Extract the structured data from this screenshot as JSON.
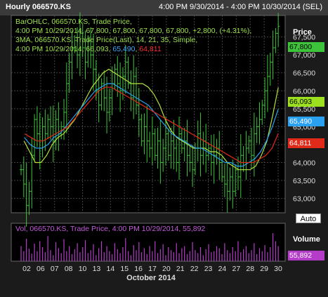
{
  "header": {
    "title": "Hourly 066570.KS",
    "range": "4:00 PM 9/30/2014 - 4:00 PM 10/30/2014 (SEL)"
  },
  "legend": {
    "line1": "BarOHLC, 066570.KS, Trade Price,",
    "line2": "4:00 PM 10/29/2014, 67,800, 67,800, 67,800, 67,800, +2,800, (+4.31%),",
    "line3": "3MA, 066570.KS, Trade Price(Last),  14, 21, 35, Simple,",
    "line4_prefix": "4:00 PM 10/29/2014, 66,093, ",
    "ma2": "65,490",
    "ma3": "64,811"
  },
  "vol_legend": "Vol, 066570.KS, Trade Price,  4:00 PM 10/29/2014, 55,892",
  "price_axis_title": "Price",
  "volume_axis_title": "Volume",
  "auto_button": "Auto",
  "tags": {
    "last": "67,800",
    "ma1": "66,093",
    "ma2": "65,490",
    "ma3": "64,811",
    "vol": "55,892"
  },
  "colors": {
    "bars": "#3ec43a",
    "ma1": "#b6e23a",
    "ma2": "#2aa0f0",
    "ma3": "#e02a1a",
    "volume": "#b43cc8",
    "grid": "#444444"
  },
  "chart_data": [
    {
      "type": "bar",
      "subtype": "ohlc",
      "y_ticks": [
        "67,500",
        "67,000",
        "66,500",
        "66,000",
        "65,500",
        "65,000",
        "64,500",
        "64,000",
        "63,500",
        "63,000"
      ],
      "ylim": [
        62600,
        68100
      ],
      "x_ticks": [
        "02",
        "06",
        "07",
        "08",
        "10",
        "13",
        "14",
        "15",
        "16",
        "17",
        "20",
        "21",
        "22",
        "23",
        "24",
        "27",
        "28",
        "29",
        "30"
      ],
      "x_title": "October 2014",
      "series": [
        {
          "name": "Price",
          "values": [
            63800,
            63400,
            62800,
            63200,
            64200,
            65200,
            64800,
            64400,
            65000,
            64800,
            65200,
            65000,
            64600,
            65200,
            64800,
            65000,
            65400,
            66200,
            66800,
            67200,
            67400,
            67000,
            67600,
            67200,
            66800,
            67400,
            67000,
            66600,
            66000,
            65600,
            66200,
            65800,
            65400,
            65800,
            66200,
            66600,
            66200,
            66000,
            66400,
            66800,
            66200,
            65800,
            66400,
            65600,
            65200,
            64600,
            65000,
            64600,
            64400,
            64800,
            64200,
            64600,
            64000,
            64400,
            64800,
            64200,
            64600,
            64400,
            64000,
            64800,
            64400,
            64600,
            64200,
            64000,
            63800,
            64400,
            64800,
            64200,
            64600,
            64200,
            64400,
            64000,
            64200,
            64400,
            64000,
            63600,
            63400,
            63200,
            63600,
            63200,
            63800,
            63600,
            64200,
            64000,
            64400,
            64600,
            64200,
            64800,
            65000,
            65200,
            65600,
            66000,
            66400,
            66800,
            67200,
            67600,
            67800
          ]
        },
        {
          "name": "3MA 14",
          "values": [
            64600,
            64300,
            64000,
            64000,
            64200,
            64500,
            64700,
            64800,
            65000,
            65200,
            65500,
            65800,
            66100,
            66300,
            66500,
            66600,
            66500,
            66400,
            66300,
            66200,
            66200,
            66200,
            66100,
            65900,
            65600,
            65200,
            64900,
            64700,
            64600,
            64500,
            64400,
            64400,
            64400,
            64300,
            64300,
            64200,
            64000,
            63900,
            63800,
            63800,
            63800,
            63900,
            64200,
            64600,
            65300,
            66093
          ]
        },
        {
          "name": "3MA 21",
          "values": [
            64700,
            64500,
            64400,
            64400,
            64500,
            64700,
            64800,
            65000,
            65200,
            65400,
            65600,
            65800,
            66000,
            66100,
            66200,
            66200,
            66100,
            66000,
            65900,
            65800,
            65700,
            65600,
            65400,
            65200,
            65000,
            64800,
            64700,
            64600,
            64500,
            64400,
            64400,
            64300,
            64200,
            64100,
            64000,
            64000,
            63900,
            63900,
            64000,
            64100,
            64300,
            64600,
            65000,
            65490
          ]
        },
        {
          "name": "3MA 35",
          "values": [
            64800,
            64700,
            64600,
            64600,
            64700,
            64800,
            64900,
            65000,
            65200,
            65400,
            65600,
            65800,
            66000,
            66100,
            66100,
            66000,
            65900,
            65800,
            65700,
            65600,
            65500,
            65400,
            65300,
            65200,
            65100,
            65000,
            64900,
            64800,
            64700,
            64600,
            64500,
            64400,
            64300,
            64200,
            64100,
            64000,
            64000,
            64000,
            64100,
            64200,
            64400,
            64811
          ]
        }
      ]
    },
    {
      "type": "bar",
      "values": [
        30,
        20,
        45,
        25,
        15,
        35,
        20,
        40,
        28,
        18,
        50,
        22,
        12,
        38,
        26,
        16,
        44,
        20,
        30,
        14,
        24,
        36,
        18,
        28,
        42,
        16,
        22,
        34,
        12,
        26,
        40,
        18,
        30,
        20,
        14,
        36,
        24,
        16,
        28,
        46,
        20,
        12,
        32,
        22,
        38,
        18,
        26,
        14,
        30,
        20,
        40,
        16,
        24,
        34,
        12,
        28,
        22,
        18,
        36,
        16,
        26,
        30,
        14,
        20,
        38,
        22,
        16,
        28,
        12,
        24,
        34,
        18,
        20,
        30,
        26,
        14,
        36,
        22,
        16,
        28,
        20,
        40,
        18,
        24,
        30,
        16,
        22,
        36,
        14,
        26,
        20,
        32,
        18,
        28,
        56,
        40,
        30
      ]
    }
  ]
}
